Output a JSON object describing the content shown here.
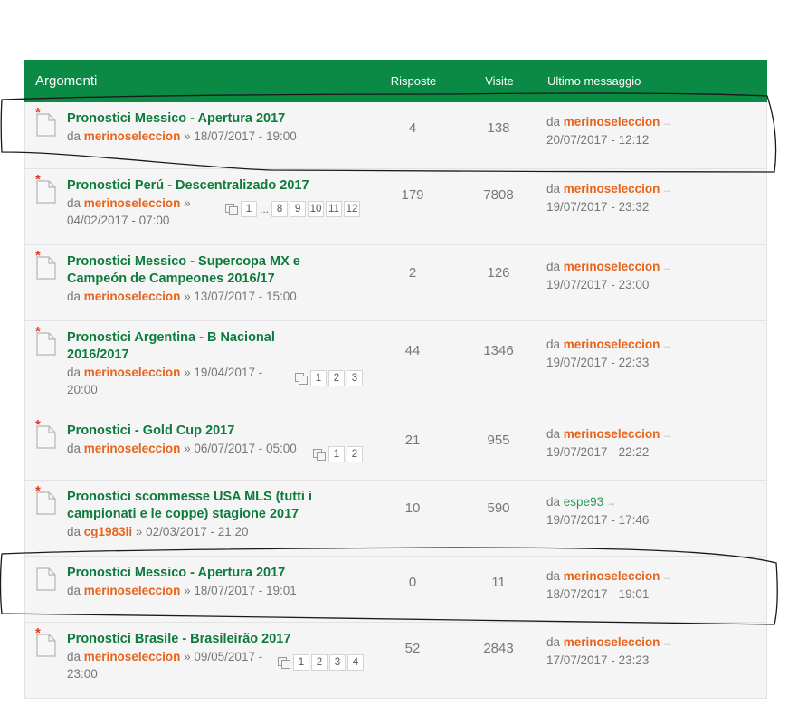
{
  "header": {
    "topics": "Argomenti",
    "replies": "Risposte",
    "views": "Visite",
    "last_post": "Ultimo messaggio"
  },
  "labels": {
    "by": "da",
    "sep": "»"
  },
  "topics": [
    {
      "title": "Pronostici Messico - Apertura 2017",
      "author": "merinoseleccion",
      "date": "18/07/2017 - 19:00",
      "replies": "4",
      "views": "138",
      "last_author": "merinoseleccion",
      "last_date": "20/07/2017 - 12:12",
      "new": true
    },
    {
      "title": "Pronostici Perú - Descentralizado 2017",
      "author": "merinoseleccion",
      "date": "04/02/2017 - 07:00",
      "replies": "179",
      "views": "7808",
      "last_author": "merinoseleccion",
      "last_date": "19/07/2017 - 23:32",
      "new": true,
      "pages": [
        "1",
        "...",
        "8",
        "9",
        "10",
        "11",
        "12"
      ]
    },
    {
      "title": "Pronostici Messico - Supercopa MX e Campeón de Campeones 2016/17",
      "author": "merinoseleccion",
      "date": "13/07/2017 - 15:00",
      "replies": "2",
      "views": "126",
      "last_author": "merinoseleccion",
      "last_date": "19/07/2017 - 23:00",
      "new": true
    },
    {
      "title": "Pronostici Argentina - B Nacional 2016/2017",
      "author": "merinoseleccion",
      "date": "19/04/2017 - 20:00",
      "replies": "44",
      "views": "1346",
      "last_author": "merinoseleccion",
      "last_date": "19/07/2017 - 22:33",
      "new": true,
      "pages": [
        "1",
        "2",
        "3"
      ]
    },
    {
      "title": "Pronostici - Gold Cup 2017",
      "author": "merinoseleccion",
      "date": "06/07/2017 - 05:00",
      "replies": "21",
      "views": "955",
      "last_author": "merinoseleccion",
      "last_date": "19/07/2017 - 22:22",
      "new": true,
      "pages": [
        "1",
        "2"
      ]
    },
    {
      "title": "Pronostici scommesse USA MLS (tutti i campionati e le coppe) stagione 2017",
      "author": "cg1983li",
      "date": "02/03/2017 - 21:20",
      "replies": "10",
      "views": "590",
      "last_author": "espe93",
      "last_date": "19/07/2017 - 17:46",
      "new": true
    },
    {
      "title": "Pronostici Messico - Apertura 2017",
      "author": "merinoseleccion",
      "date": "18/07/2017 - 19:01",
      "replies": "0",
      "views": "11",
      "last_author": "merinoseleccion",
      "last_date": "18/07/2017 - 19:01",
      "new": false
    },
    {
      "title": "Pronostici Brasile - Brasileirão 2017",
      "author": "merinoseleccion",
      "date": "09/05/2017 - 23:00",
      "replies": "52",
      "views": "2843",
      "last_author": "merinoseleccion",
      "last_date": "17/07/2017 - 23:23",
      "new": true,
      "pages": [
        "1",
        "2",
        "3",
        "4"
      ]
    }
  ],
  "colors": {
    "header_bg": "#0b8a46",
    "title": "#0e7a3c",
    "author": "#e8641c",
    "new_marker": "#e03a1e"
  }
}
